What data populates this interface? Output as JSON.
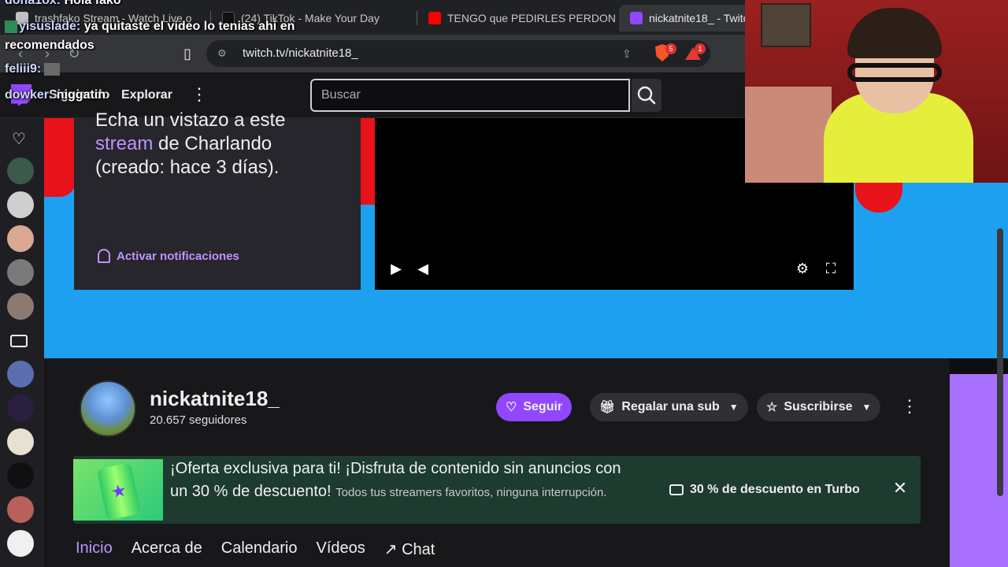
{
  "browser": {
    "tabs": [
      {
        "title": "trashfako Stream - Watch Live o",
        "color": "#c0c0c0",
        "active": false
      },
      {
        "title": "(24) TikTok - Make Your Day",
        "color": "#000000",
        "active": false
      },
      {
        "title": "TENGO que PEDIRLES PERDON -",
        "color": "#ff0000",
        "active": false
      },
      {
        "title": "nickatnite18_ - Twitc",
        "color": "#9147ff",
        "active": true
      }
    ],
    "url": "twitch.tv/nickatnite18_",
    "brave_badge": "5",
    "alert_badge": "1"
  },
  "twitch_nav": {
    "following": "Siguiendo",
    "browse": "Explorar",
    "search_placeholder": "Buscar"
  },
  "offline": {
    "line1": "Echa un vistazo a este",
    "highlight": "stream",
    "line2": " de Charlando",
    "line3": "(creado: hace 3 días).",
    "notify": "Activar notificaciones"
  },
  "channel": {
    "name": "nickatnite18_",
    "followers": "20.657 seguidores",
    "follow": "Seguir",
    "gift": "Regalar una sub",
    "subscribe": "Suscribirse"
  },
  "promo": {
    "title": "¡Oferta exclusiva para ti! ¡Disfruta de contenido sin anuncios con un 30 % de descuento!",
    "desc": "Todos tus streamers favoritos, ninguna interrupción.",
    "cta": "30 % de descuento en Turbo"
  },
  "tabs": [
    "Inicio",
    "Acerca de",
    "Calendario",
    "Vídeos",
    "Chat"
  ],
  "chat": [
    {
      "user": "dona1ox:",
      "msg": "Hola fako"
    },
    {
      "user": "yisuslade:",
      "msg": "ya quitaste el video lo tenias ahi en recomendados"
    },
    {
      "user": "feliii9:",
      "msg": ""
    },
    {
      "user": "dowker:",
      "msg": "niggatin"
    }
  ],
  "colors": {
    "twitch_purple": "#9147ff",
    "banner_blue": "#1ea0f0",
    "accent_text": "#bf94ff"
  }
}
